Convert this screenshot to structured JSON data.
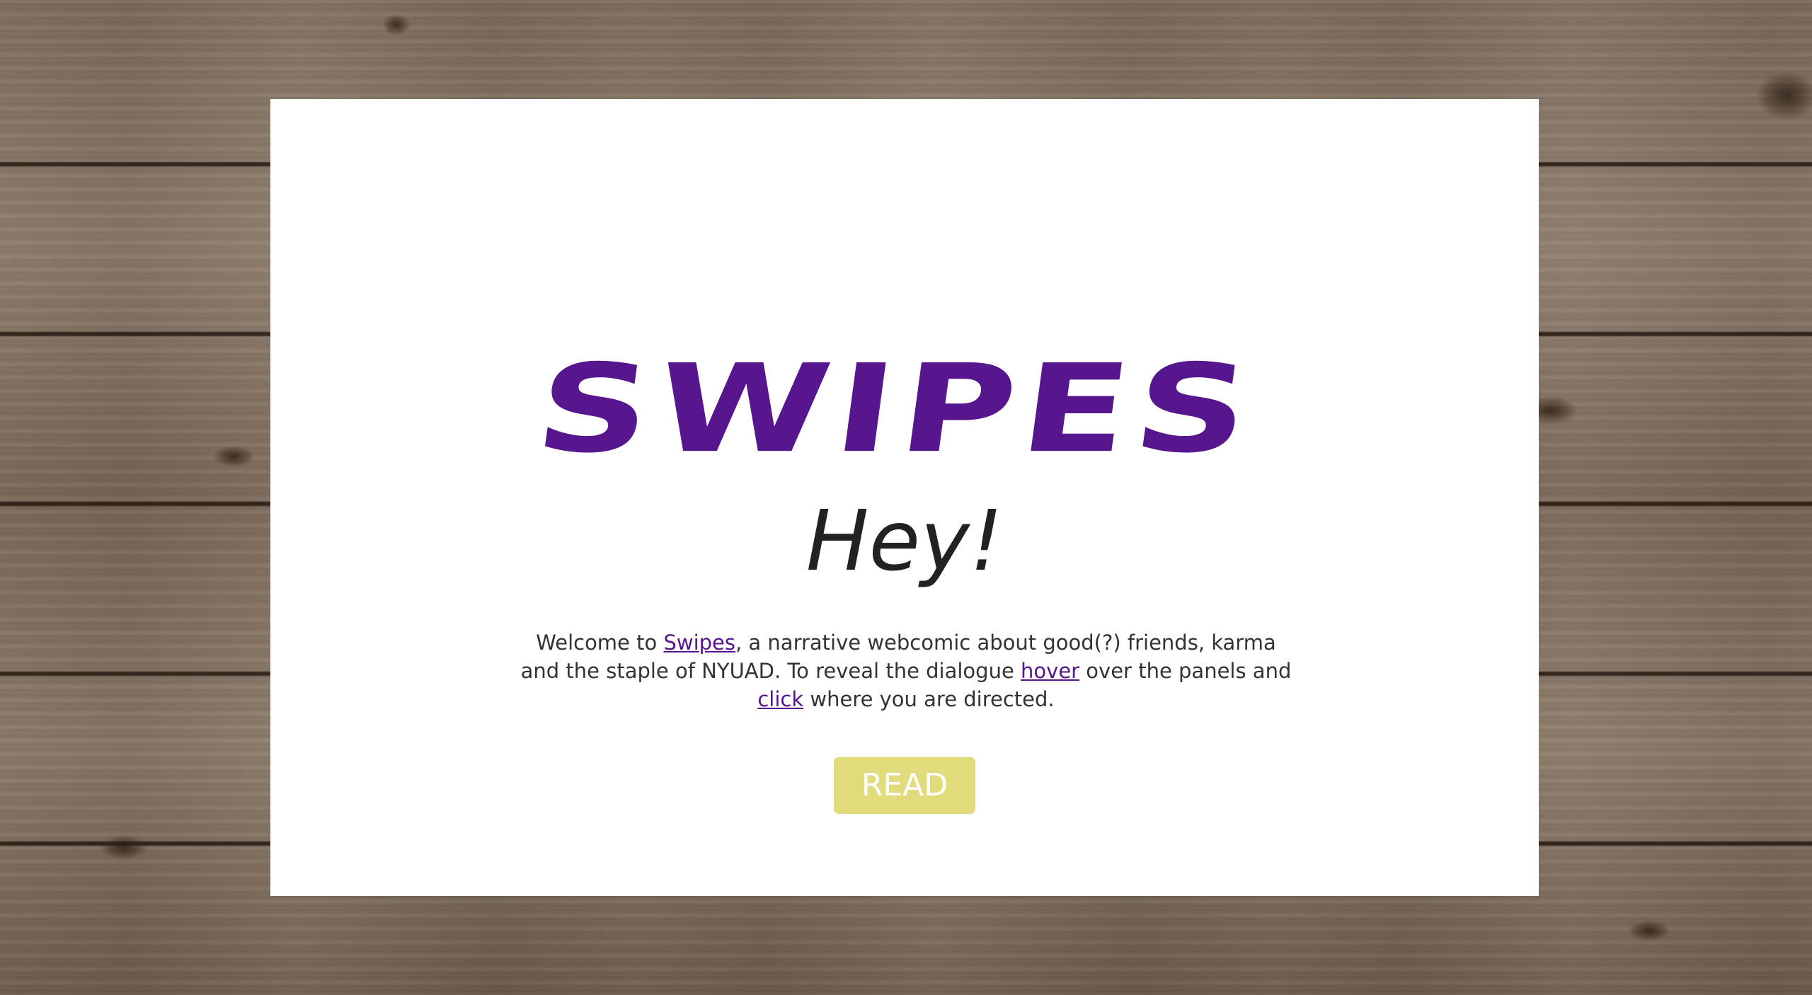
{
  "page": {
    "background": "wood-planks",
    "accent_color": "#56168d",
    "button_color": "#e2db7c"
  },
  "card": {
    "logo_text": "SWIPES",
    "greeting": "Hey!",
    "intro": {
      "text_1": "Welcome to ",
      "link_swipes": "Swipes",
      "text_2": ", a narrative webcomic about good(?) friends, karma and the staple of NYUAD. To reveal the dialogue ",
      "link_hover": "hover",
      "text_3": " over the panels and ",
      "link_click": "click",
      "text_4": " where you are directed."
    },
    "read_button": "READ"
  }
}
